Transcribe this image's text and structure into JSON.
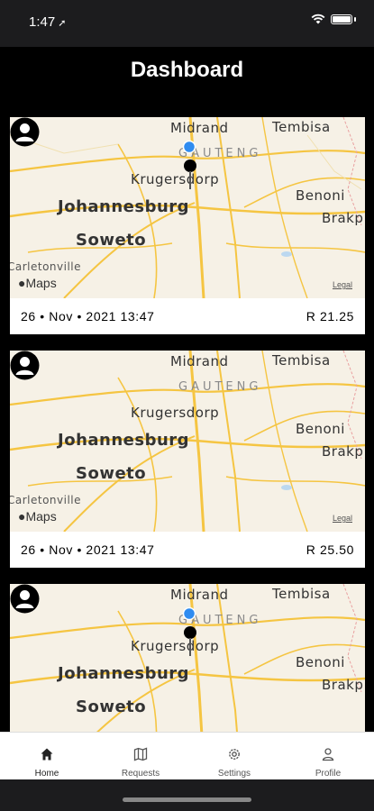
{
  "status": {
    "time": "1:47",
    "location_glyph": "➚"
  },
  "header": {
    "title": "Dashboard"
  },
  "map_labels": {
    "midrand": "Midrand",
    "tembisa": "Tembisa",
    "gauteng": "GAUTENG",
    "krugersdorp": "Krugersdorp",
    "benoni": "Benoni",
    "johannesburg": "Johannesburg",
    "brakpan": "Brakp",
    "soweto": "Soweto",
    "carletonville": "Carletonville",
    "maps": "Maps",
    "legal": "Legal"
  },
  "trips": [
    {
      "date": "26 • Nov • 2021  13:47",
      "price": "R 21.25"
    },
    {
      "date": "26 • Nov • 2021  13:47",
      "price": "R 25.50"
    },
    {
      "date": "",
      "price": ""
    }
  ],
  "tabs": [
    {
      "label": "Home",
      "icon": "home-icon"
    },
    {
      "label": "Requests",
      "icon": "map-icon"
    },
    {
      "label": "Settings",
      "icon": "gear-icon"
    },
    {
      "label": "Profile",
      "icon": "person-icon"
    }
  ],
  "colors": {
    "accent": "#000000",
    "road": "#f5c542",
    "pin_blue": "#2f8cf0"
  }
}
